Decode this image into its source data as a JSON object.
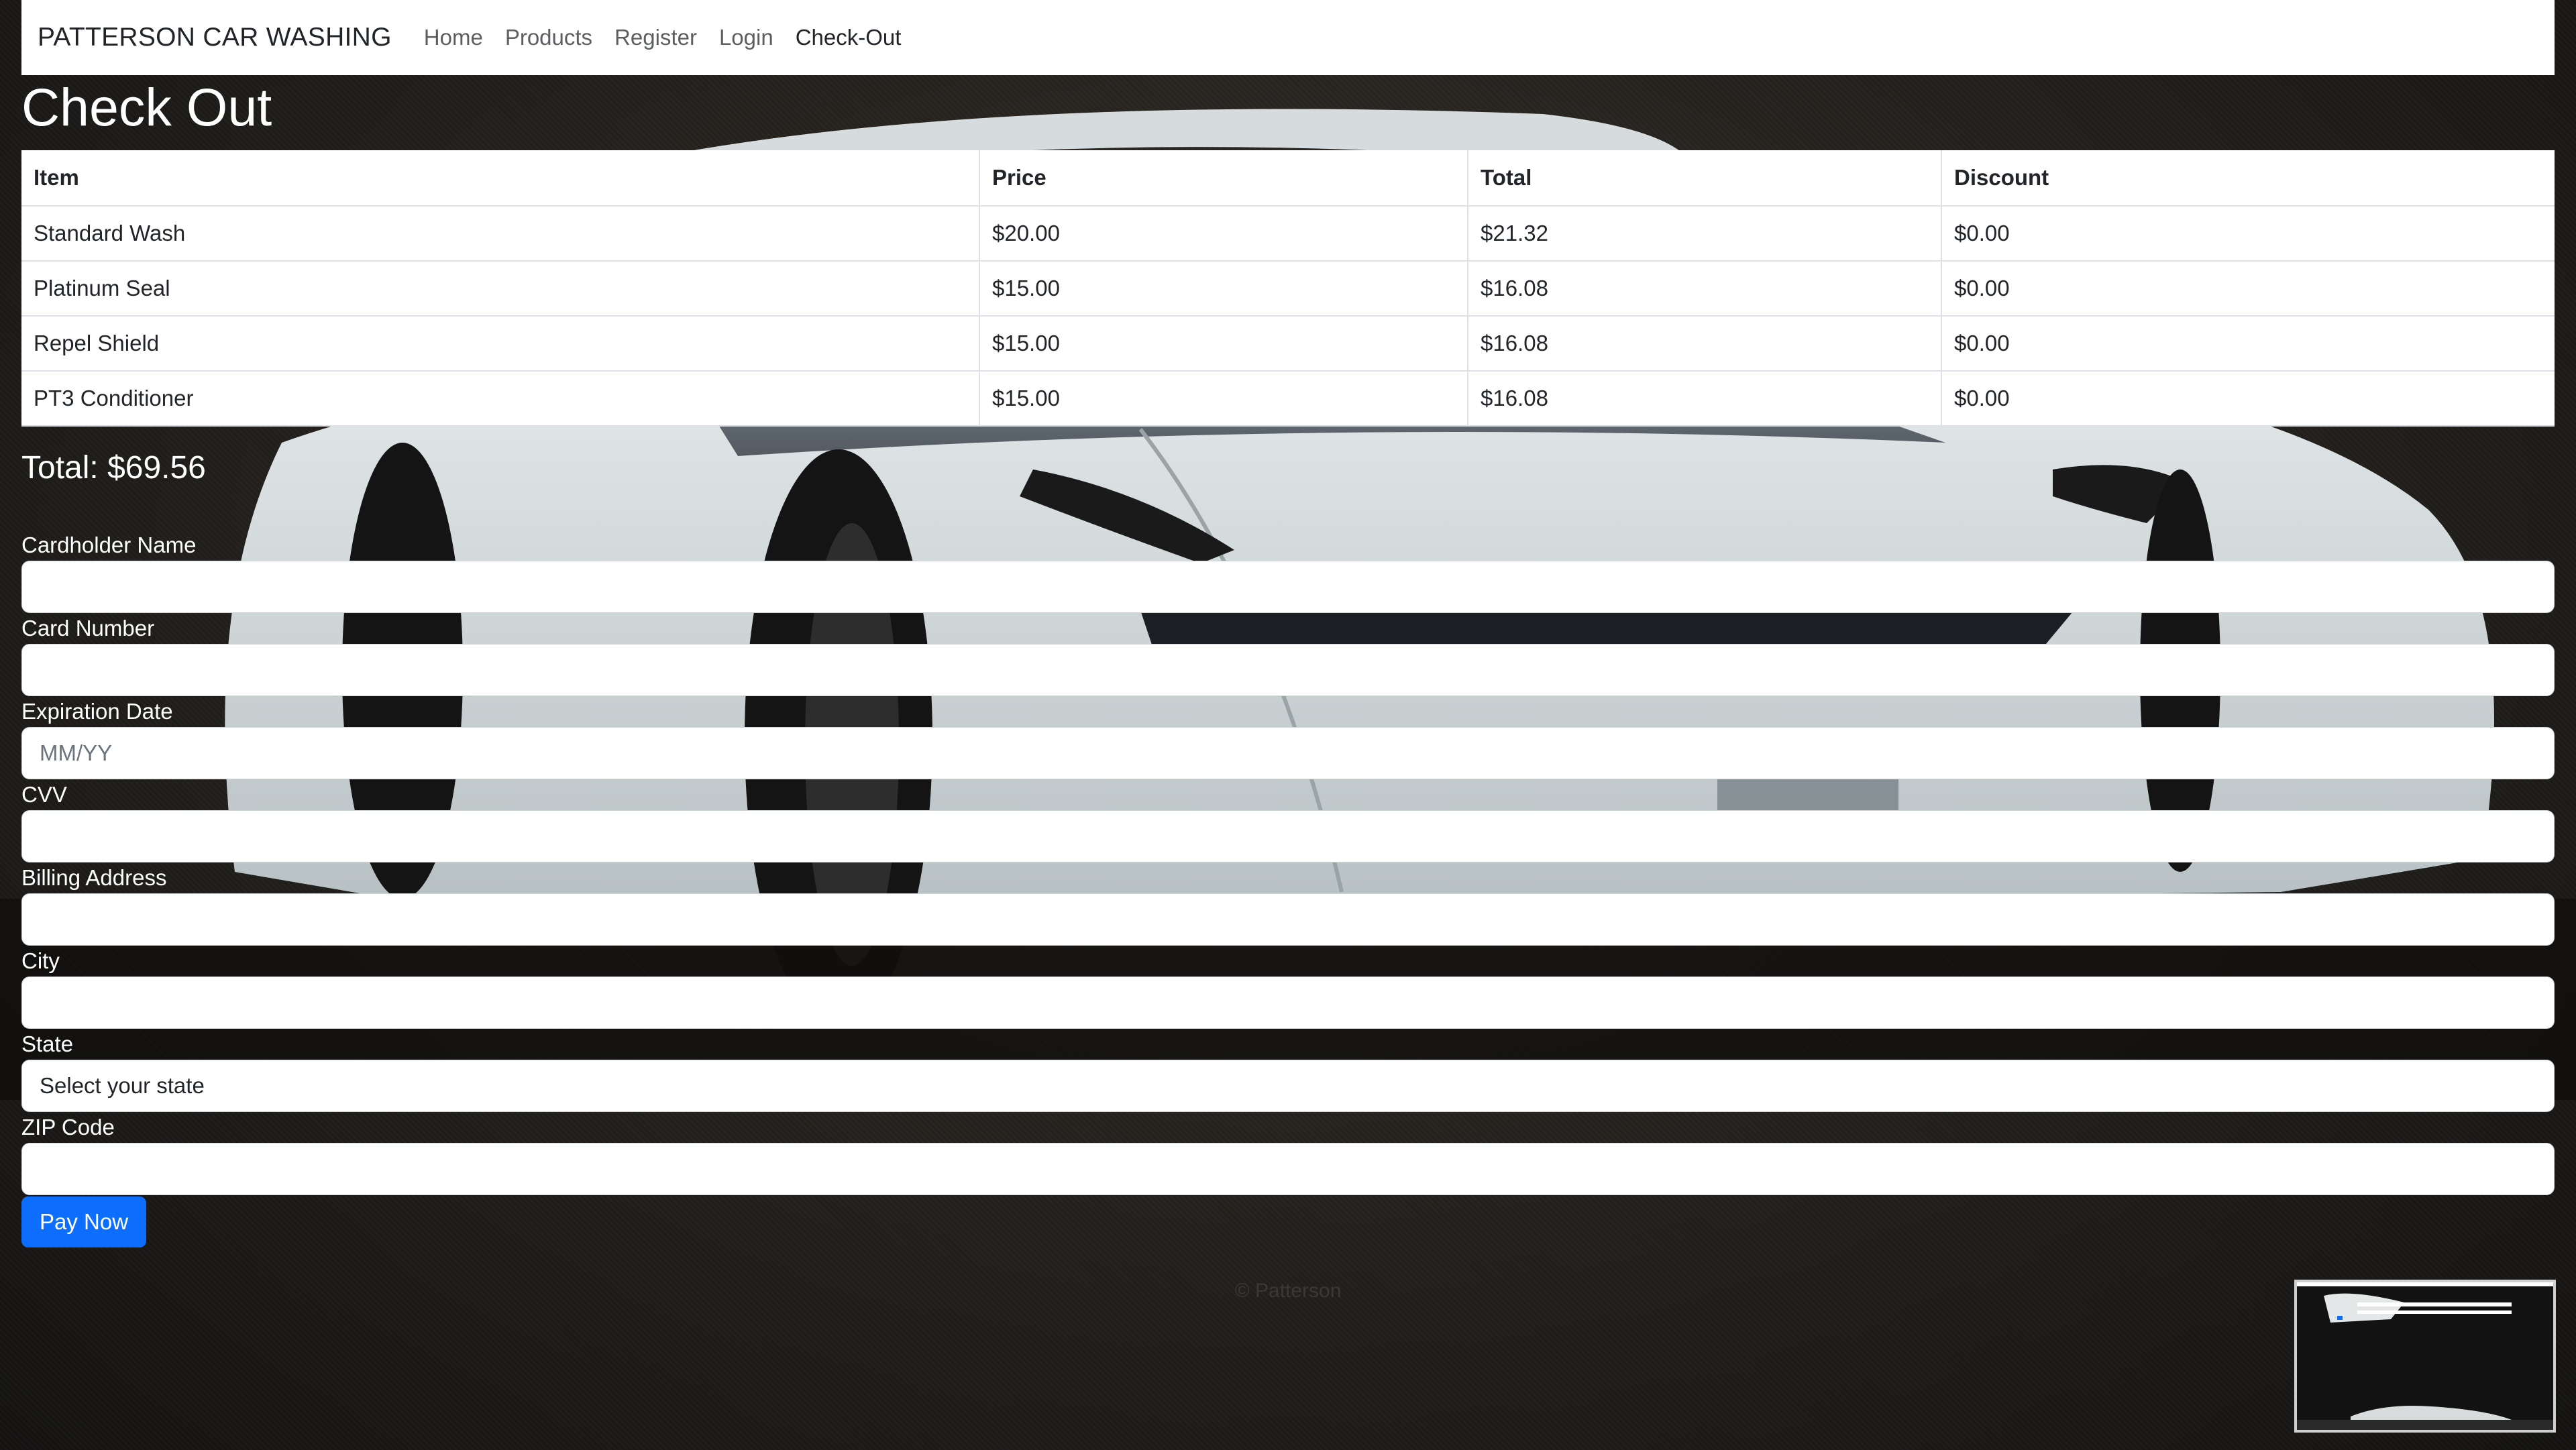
{
  "navbar": {
    "brand": "PATTERSON CAR WASHING",
    "links": [
      {
        "label": "Home"
      },
      {
        "label": "Products"
      },
      {
        "label": "Register"
      },
      {
        "label": "Login"
      },
      {
        "label": "Check-Out"
      }
    ]
  },
  "page_title": "Check Out",
  "table": {
    "headers": [
      "Item",
      "Price",
      "Total",
      "Discount"
    ],
    "rows": [
      {
        "item": "Standard Wash",
        "price": "$20.00",
        "total": "$21.32",
        "discount": "$0.00"
      },
      {
        "item": "Platinum Seal",
        "price": "$15.00",
        "total": "$16.08",
        "discount": "$0.00"
      },
      {
        "item": "Repel Shield",
        "price": "$15.00",
        "total": "$16.08",
        "discount": "$0.00"
      },
      {
        "item": "PT3 Conditioner",
        "price": "$15.00",
        "total": "$16.08",
        "discount": "$0.00"
      }
    ]
  },
  "grand_total": "Total: $69.56",
  "form": {
    "cardholder_label": "Cardholder Name",
    "card_number_label": "Card Number",
    "expiration_label": "Expiration Date",
    "expiration_placeholder": "MM/YY",
    "cvv_label": "CVV",
    "billing_label": "Billing Address",
    "city_label": "City",
    "state_label": "State",
    "state_selected": "Select your state",
    "zip_label": "ZIP Code",
    "pay_button": "Pay Now"
  },
  "footer": "© Patterson",
  "colors": {
    "primary": "#0d6efd",
    "nav_bg": "#ffffff",
    "text_on_dark": "#ffffff"
  }
}
